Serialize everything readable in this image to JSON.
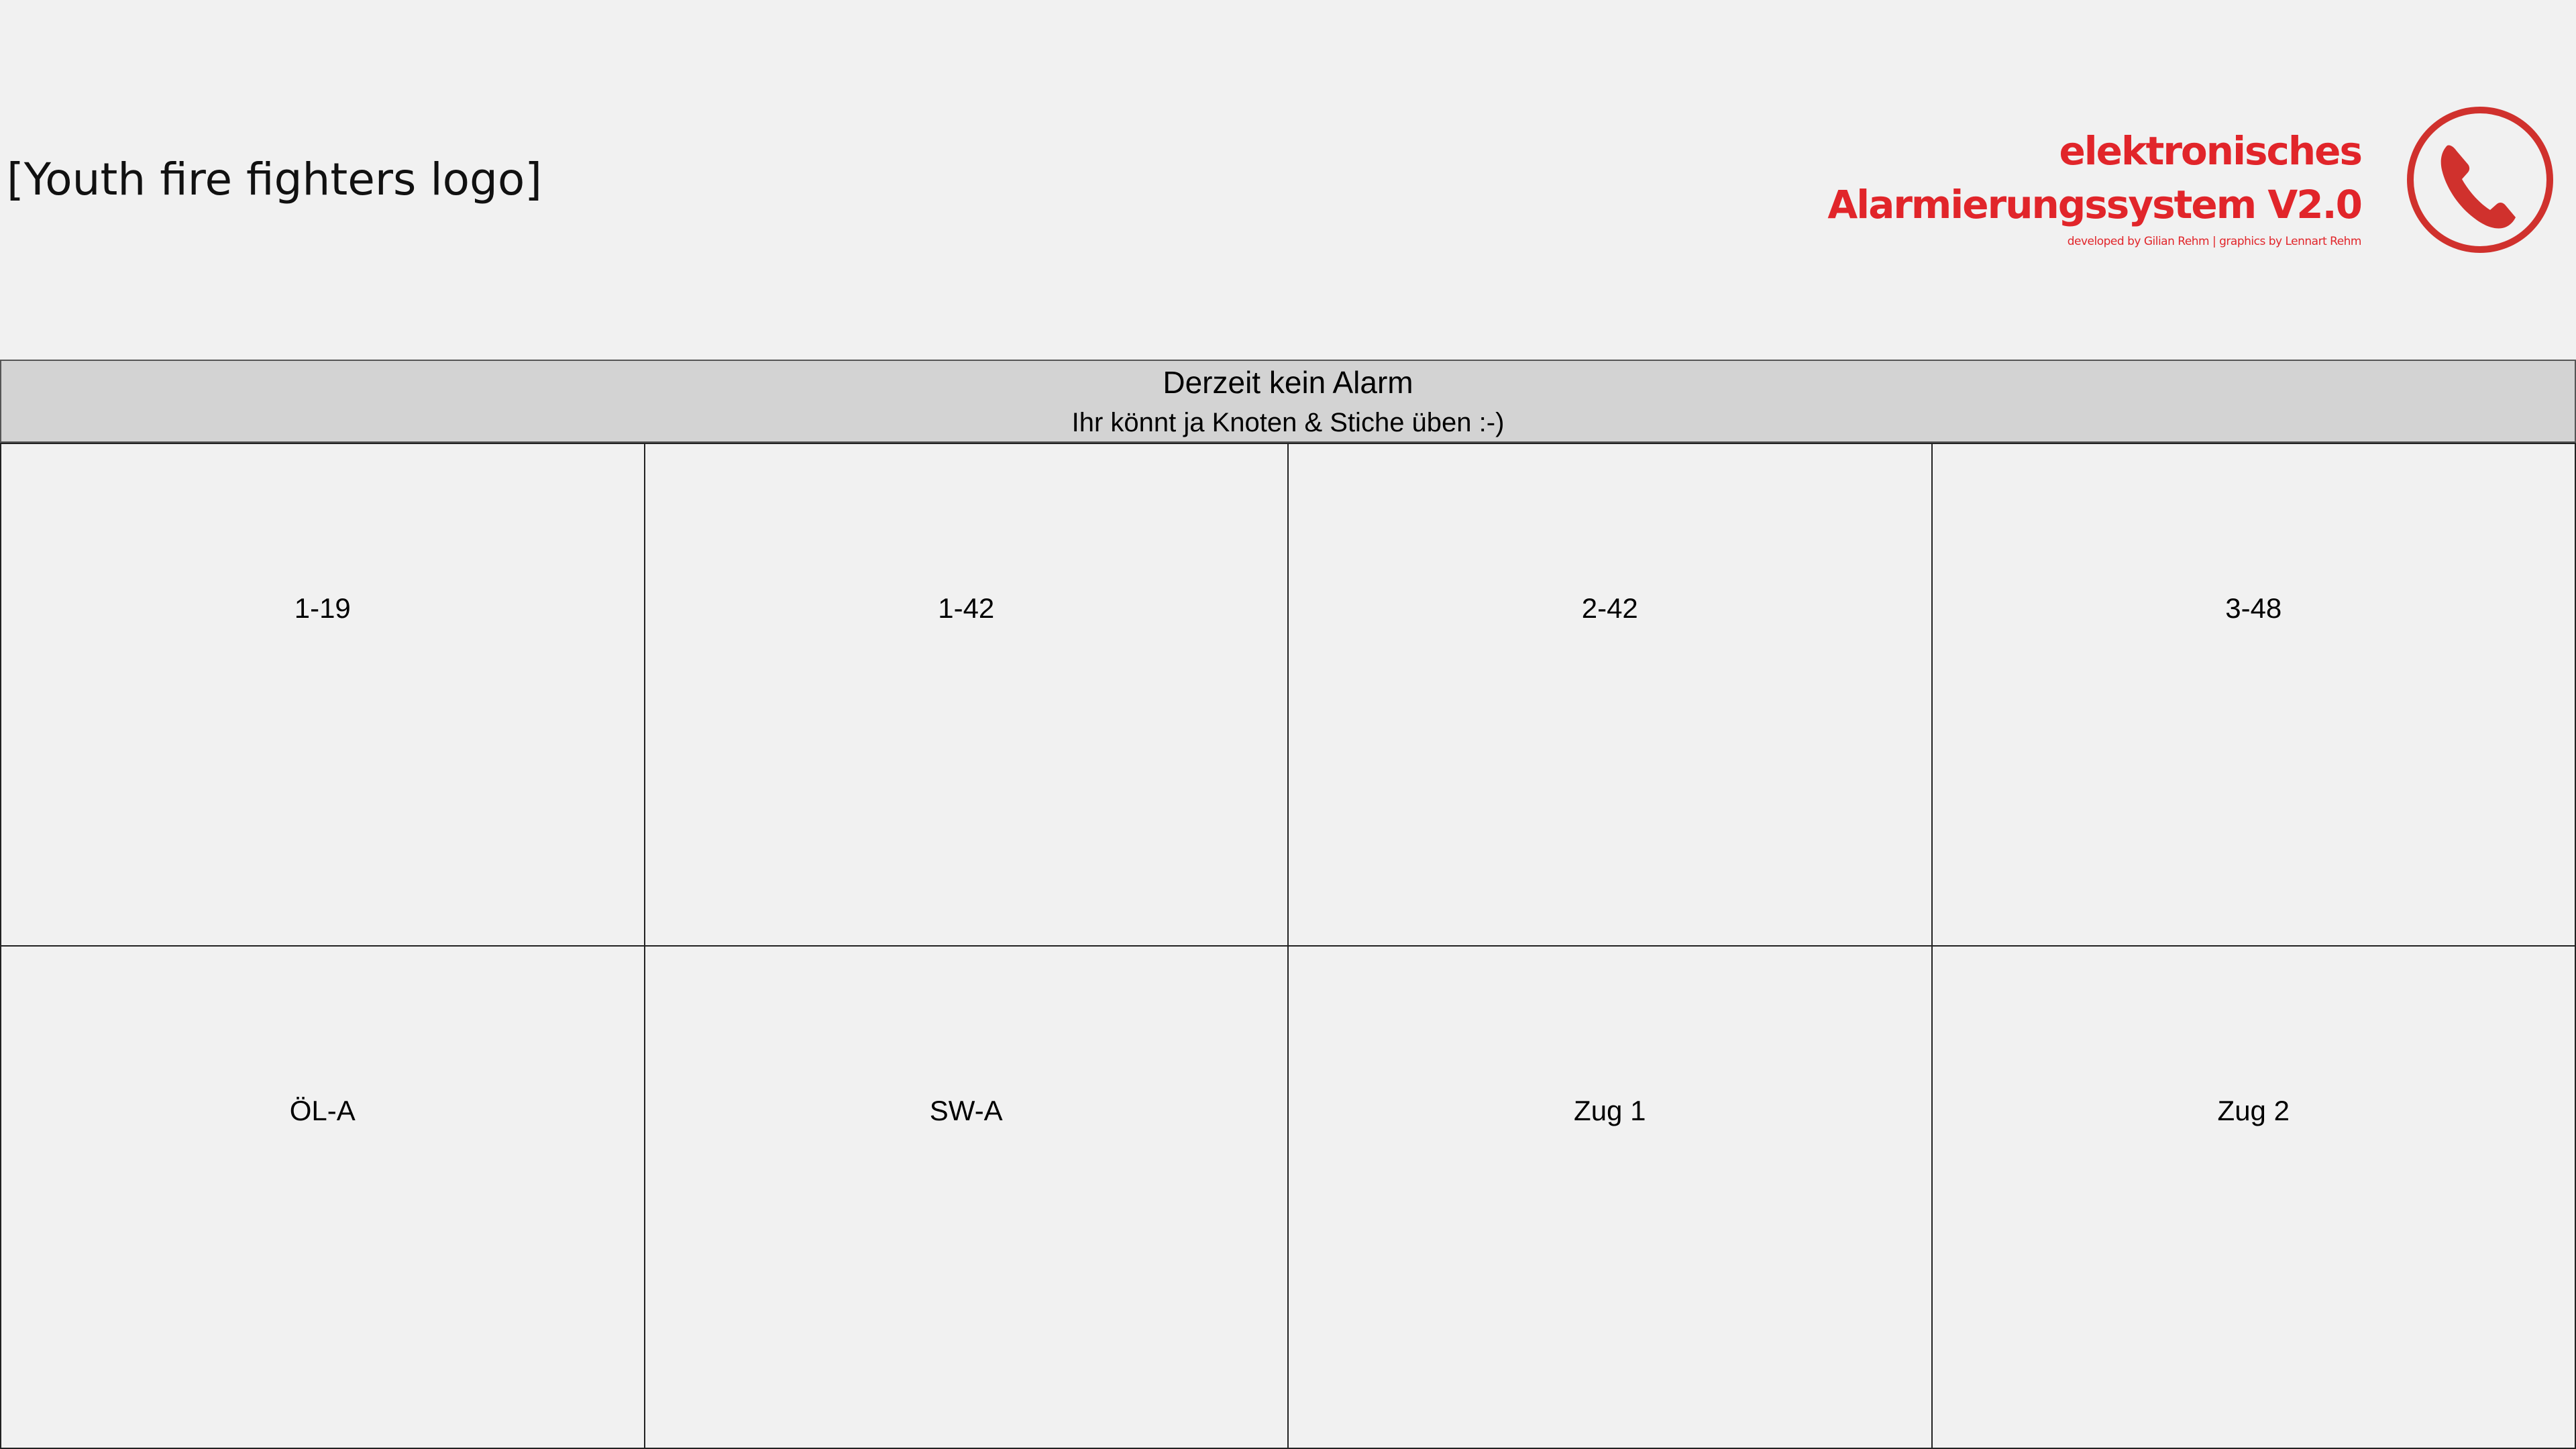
{
  "header": {
    "logo_left_text": "[Youth fire fighters logo]",
    "brand": {
      "line1": "elektronisches",
      "line2": "Alarmierungssystem V2.0",
      "credits": "developed by  Gilian Rehm  |  graphics by Lennart Rehm",
      "color": "#e1252a",
      "icon": "phone-icon"
    }
  },
  "status": {
    "title": "Derzeit kein Alarm",
    "subtitle": "Ihr könnt ja Knoten & Stiche üben :-)"
  },
  "units": [
    {
      "label": "1-19"
    },
    {
      "label": "1-42"
    },
    {
      "label": "2-42"
    },
    {
      "label": "3-48"
    },
    {
      "label": "ÖL-A"
    },
    {
      "label": "SW-A"
    },
    {
      "label": "Zug 1"
    },
    {
      "label": "Zug 2"
    }
  ]
}
